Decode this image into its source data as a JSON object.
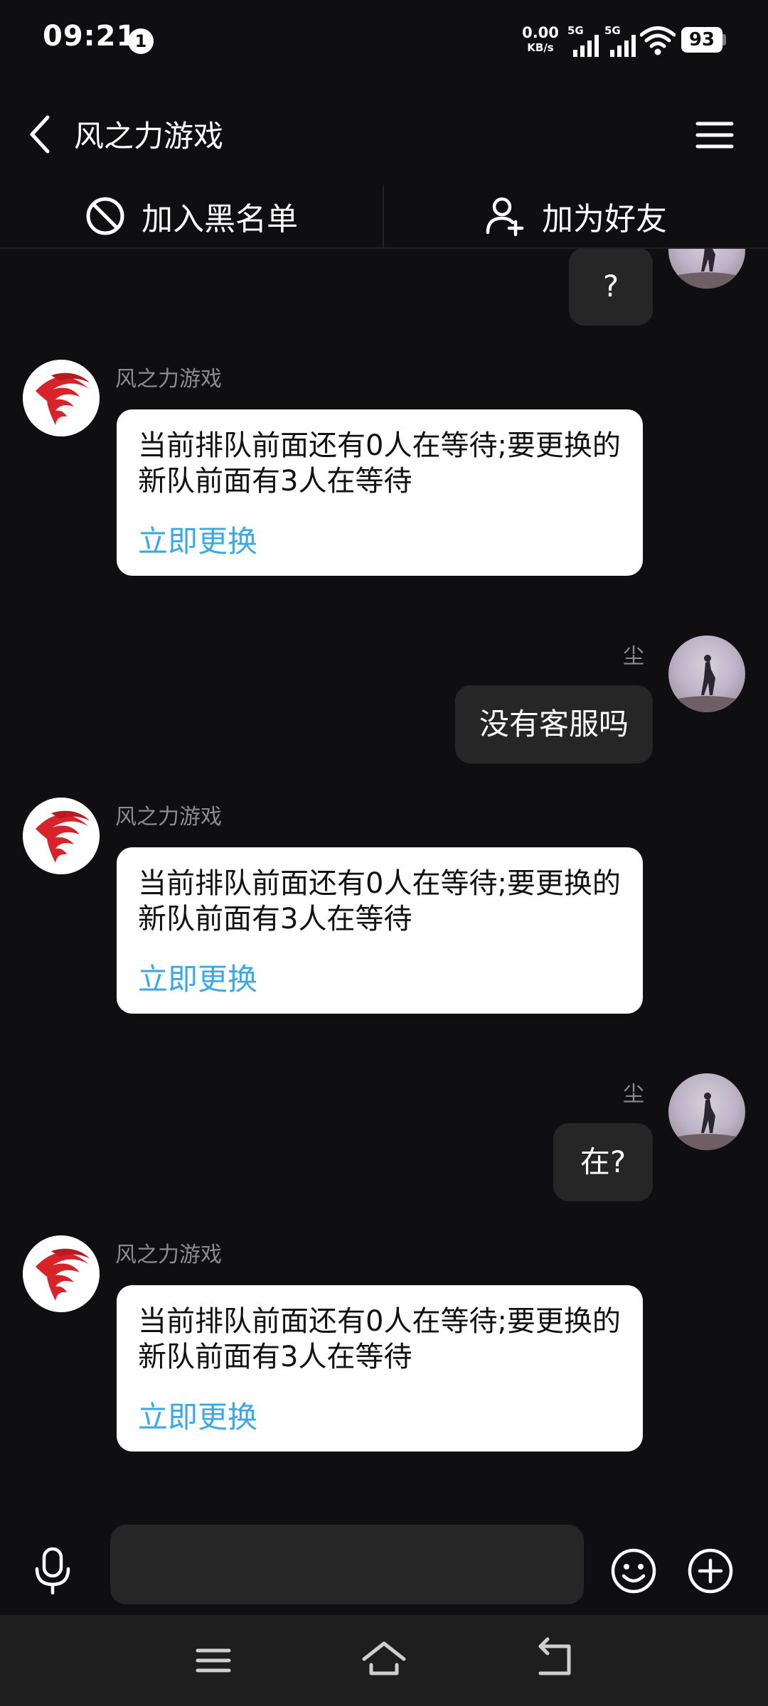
{
  "status_bar": {
    "time": "09:21",
    "notification_count": "1",
    "net_speed_value": "0.00",
    "net_speed_unit": "KB/s",
    "sim1_label": "5G",
    "sim2_label": "5G",
    "battery_level": "93"
  },
  "header": {
    "title": "风之力游戏",
    "back_icon": "chevron-left-icon",
    "menu_icon": "hamburger-menu-icon"
  },
  "actions": {
    "blacklist_label": "加入黑名单",
    "add_friend_label": "加为好友"
  },
  "messages": [
    {
      "from": "user",
      "text": "?"
    },
    {
      "from": "game",
      "sender": "风之力游戏",
      "text": "当前排队前面还有0人在等待;要更换的新队前面有3人在等待",
      "link": "立即更换"
    },
    {
      "from": "user",
      "sender": "尘",
      "text": "没有客服吗"
    },
    {
      "from": "game",
      "sender": "风之力游戏",
      "text": "当前排队前面还有0人在等待;要更换的新队前面有3人在等待",
      "link": "立即更换"
    },
    {
      "from": "user",
      "sender": "尘",
      "text": "在?"
    },
    {
      "from": "game",
      "sender": "风之力游戏",
      "text": "当前排队前面还有0人在等待;要更换的新队前面有3人在等待",
      "link": "立即更换"
    }
  ],
  "input": {
    "value": "",
    "placeholder": ""
  },
  "colors": {
    "background": "#0f0f11",
    "bubble_self": "#262626",
    "bubble_other": "#ffffff",
    "link": "#3aa9e6",
    "brand_red": "#d8232a"
  }
}
